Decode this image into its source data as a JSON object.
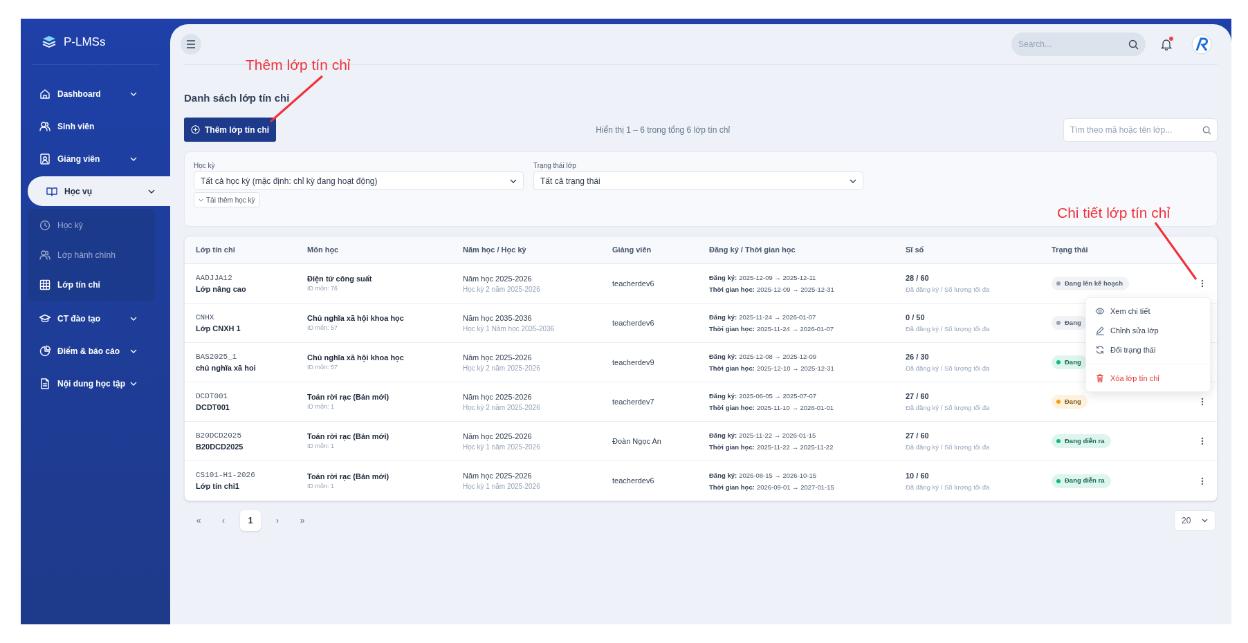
{
  "app": {
    "name": "P-LMSs"
  },
  "sidebar": {
    "items": [
      {
        "label": "Dashboard",
        "expandable": true,
        "selected": false
      },
      {
        "label": "Sinh viên",
        "expandable": false,
        "selected": false
      },
      {
        "label": "Giảng viên",
        "expandable": true,
        "selected": false
      },
      {
        "label": "Học vụ",
        "expandable": true,
        "selected": true,
        "children": [
          {
            "label": "Học kỳ",
            "selected": false
          },
          {
            "label": "Lớp hành chính",
            "selected": false
          },
          {
            "label": "Lớp tín chỉ",
            "selected": true
          }
        ]
      },
      {
        "label": "CT đào tạo",
        "expandable": true,
        "selected": false
      },
      {
        "label": "Điểm & báo cáo",
        "expandable": true,
        "selected": false
      },
      {
        "label": "Nội dung học tập",
        "expandable": true,
        "selected": false
      }
    ]
  },
  "header": {
    "search_placeholder": "Search...",
    "notification_dot": true
  },
  "page": {
    "title": "Danh sách lớp tín chỉ",
    "add_button": "Thêm lớp tín chỉ",
    "summary": "Hiển thị 1 – 6 trong tổng 6 lớp tín chỉ",
    "search_placeholder": "Tìm theo mã hoặc tên lớp..."
  },
  "filters": [
    {
      "label": "Học kỳ",
      "value": "Tất cả học kỳ (mặc định: chỉ kỳ đang hoạt động)"
    },
    {
      "label": "Trạng thái lớp",
      "value": "Tất cả trạng thái"
    }
  ],
  "load_more": "Tải thêm học kỳ",
  "table": {
    "columns": [
      "Lớp tín chỉ",
      "Môn học",
      "Năm học / Học kỳ",
      "Giảng viên",
      "Đăng ký / Thời gian học",
      "Sĩ số",
      "Trạng thái"
    ],
    "rows": [
      {
        "code": "AADJJA12",
        "name": "Lớp nâng cao",
        "subject": "Điện tử công suất",
        "subject_id": "ID môn: 76",
        "year": "Năm học 2025-2026",
        "semester": "Học kỳ 2 năm 2025-2026",
        "lecturer": "teacherdev6",
        "registration_label": "Đăng ký:",
        "registration": "2025-12-09 → 2025-12-11",
        "study_label": "Thời gian học:",
        "study": "2025-12-09 → 2025-12-31",
        "enrolled": "28 / 60",
        "enrolled_note": "Đã đăng ký / Số lượng tối đa",
        "status": {
          "text": "Đang lên kế hoạch",
          "color": "#94a3b8"
        },
        "menu_button": true
      },
      {
        "code": "CNHX",
        "name": "Lớp CNXH 1",
        "subject": "Chủ nghĩa xã hội khoa học",
        "subject_id": "ID môn: 57",
        "year": "Năm học 2035-2036",
        "semester": "Học kỳ 1 Năm học 2035-2036",
        "lecturer": "teacherdev6",
        "registration_label": "Đăng ký:",
        "registration": "2025-11-24 → 2026-01-07",
        "study_label": "Thời gian học:",
        "study": "2025-11-24 → 2026-01-07",
        "enrolled": "0 / 50",
        "enrolled_note": "Đã đăng ký / Số lượng tối đa",
        "status": {
          "text": "Đang",
          "color": "#94a3b8"
        }
      },
      {
        "code": "BAS2025_1",
        "name": "chủ nghĩa xã hoi",
        "subject": "Chủ nghĩa xã hội khoa học",
        "subject_id": "ID môn: 57",
        "year": "Năm học 2025-2026",
        "semester": "Học kỳ 2 năm 2025-2026",
        "lecturer": "teacherdev9",
        "registration_label": "Đăng ký:",
        "registration": "2025-12-08 → 2025-12-09",
        "study_label": "Thời gian học:",
        "study": "2025-12-10 → 2025-12-31",
        "enrolled": "26 / 30",
        "enrolled_note": "Đã đăng ký / Số lượng tối đa",
        "status": {
          "text": "Đang",
          "color": "#10b981"
        }
      },
      {
        "code": "DCDT001",
        "name": "DCDT001",
        "subject": "Toán rời rạc (Bản mới)",
        "subject_id": "ID môn: 1",
        "year": "Năm học 2025-2026",
        "semester": "Học kỳ 2 năm 2025-2026",
        "lecturer": "teacherdev7",
        "registration_label": "Đăng ký:",
        "registration": "2025-06-05 → 2025-07-07",
        "study_label": "Thời gian học:",
        "study": "2025-11-10 → 2026-01-01",
        "enrolled": "27 / 60",
        "enrolled_note": "Đã đăng ký / Số lượng tối đa",
        "status": {
          "text": "Đang",
          "color": "#f59e0b"
        },
        "menu_button": true
      },
      {
        "code": "B20DCD2025",
        "name": "B20DCD2025",
        "subject": "Toán rời rạc (Bản mới)",
        "subject_id": "ID môn: 1",
        "year": "Năm học 2025-2026",
        "semester": "Học kỳ 1 năm 2025-2026",
        "lecturer": "Đoàn Ngọc An",
        "registration_label": "Đăng ký:",
        "registration": "2025-11-22 → 2026-01-15",
        "study_label": "Thời gian học:",
        "study": "2025-11-22 → 2025-11-22",
        "enrolled": "27 / 60",
        "enrolled_note": "Đã đăng ký / Số lượng tối đa",
        "status": {
          "text": "Đang diễn ra",
          "color": "#10b981"
        },
        "menu_button": true
      },
      {
        "code": "CS101-H1-2026",
        "name": "Lớp tín chỉ1",
        "subject": "Toán rời rạc (Bản mới)",
        "subject_id": "ID môn: 1",
        "year": "Năm học 2025-2026",
        "semester": "Học kỳ 1 năm 2025-2026",
        "lecturer": "teacherdev6",
        "registration_label": "Đăng ký:",
        "registration": "2026-08-15 → 2026-10-15",
        "study_label": "Thời gian học:",
        "study": "2026-09-01 → 2027-01-15",
        "enrolled": "10 / 60",
        "enrolled_note": "Đã đăng ký / Số lượng tối đa",
        "status": {
          "text": "Đang diễn ra",
          "color": "#10b981"
        },
        "menu_button": true
      }
    ]
  },
  "action_menu": {
    "items": [
      {
        "label": "Xem chi tiết",
        "danger": false
      },
      {
        "label": "Chỉnh sửa lớp",
        "danger": false
      },
      {
        "label": "Đổi trạng thái",
        "danger": false
      },
      {
        "label": "Xóa lớp tín chỉ",
        "danger": true
      }
    ]
  },
  "pagination": [
    {
      "label": "«",
      "kind": "nav",
      "selected": false
    },
    {
      "label": "‹",
      "kind": "nav",
      "selected": false
    },
    {
      "label": "1",
      "kind": "page",
      "selected": true
    },
    {
      "label": "›",
      "kind": "nav",
      "selected": false
    },
    {
      "label": "»",
      "kind": "nav",
      "selected": false
    }
  ],
  "page_size": "20",
  "annotations": [
    {
      "text": "Thêm lớp tín chỉ"
    },
    {
      "text": "Chi tiết lớp tín chỉ"
    }
  ]
}
